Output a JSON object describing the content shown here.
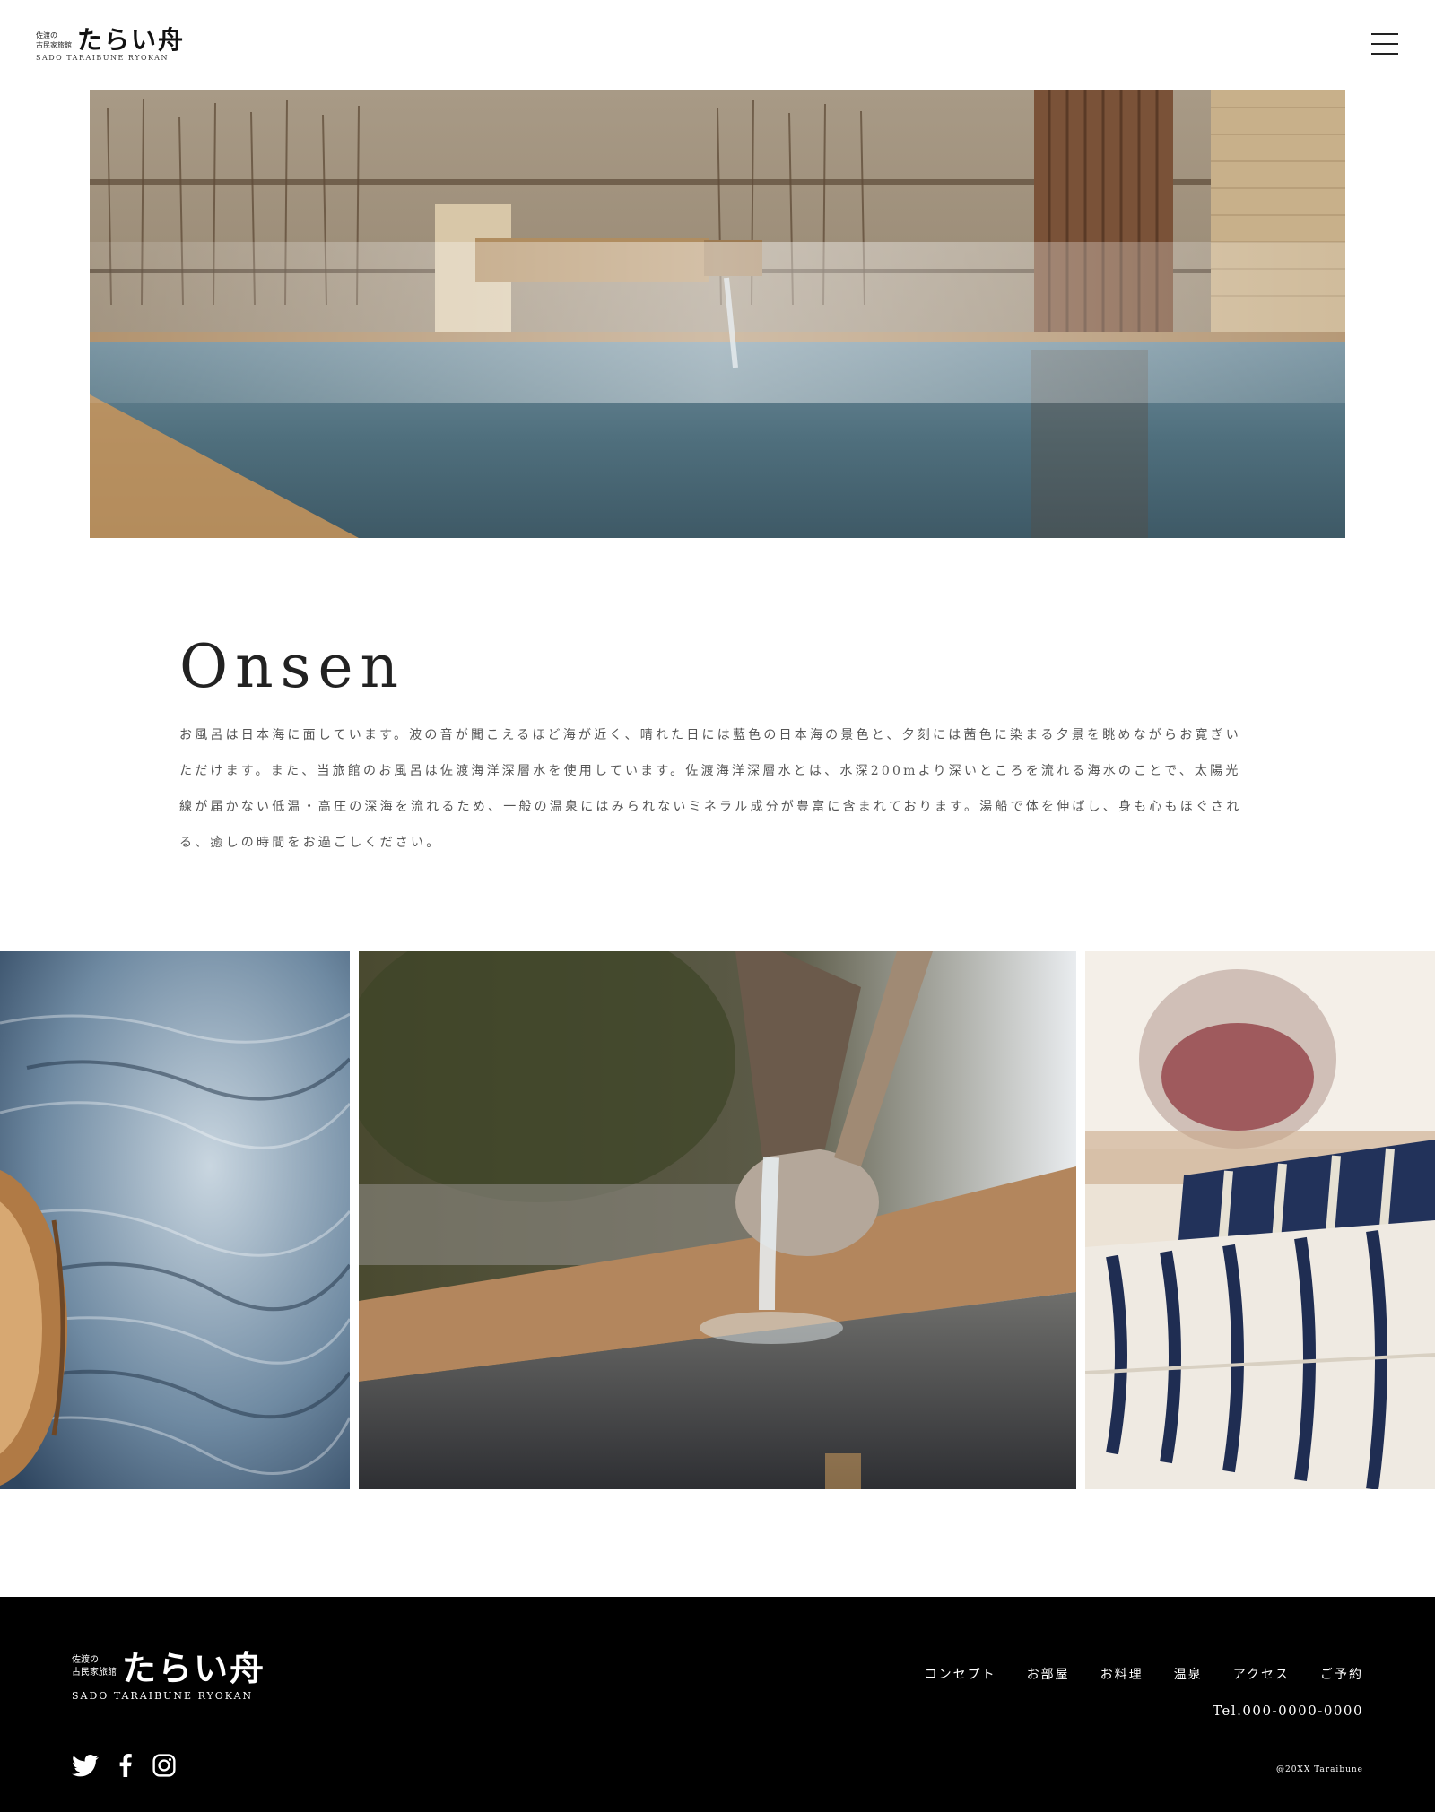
{
  "header": {
    "logo": {
      "prefix_line1": "佐渡の",
      "prefix_line2": "古民家旅館",
      "name": "たらい舟",
      "english": "SADO TARAIBUNE RYOKAN"
    },
    "menu_icon": "hamburger-menu-icon"
  },
  "hero": {
    "image": "steaming-outdoor-onsen-photo"
  },
  "section": {
    "title": "Onsen",
    "body": "お風呂は日本海に面しています。波の音が聞こえるほど海が近く、晴れた日には藍色の日本海の景色と、夕刻には茜色に染まる夕景を眺めながらお寛ぎいただけます。また、当旅館のお風呂は佐渡海洋深層水を使用しています。佐渡海洋深層水とは、水深200mより深いところを流れる海水のことで、太陽光線が届かない低温・高圧の深海を流れるため、一般の温泉にはみられないミネラル成分が豊富に含まれております。湯船で体を伸ばし、身も心もほぐされる、癒しの時間をお過ごしください。"
  },
  "gallery": [
    "wooden-bucket-water-photo",
    "bamboo-spout-hot-spring-photo",
    "folded-tenugui-towels-photo"
  ],
  "footer": {
    "logo": {
      "prefix_line1": "佐渡の",
      "prefix_line2": "古民家旅館",
      "name": "たらい舟",
      "english": "SADO TARAIBUNE RYOKAN"
    },
    "nav": [
      "コンセプト",
      "お部屋",
      "お料理",
      "温泉",
      "アクセス",
      "ご予約"
    ],
    "tel": "Tel.000-0000-0000",
    "social": [
      "twitter-icon",
      "facebook-icon",
      "instagram-icon"
    ],
    "copyright": "@20XX Taraibune"
  }
}
